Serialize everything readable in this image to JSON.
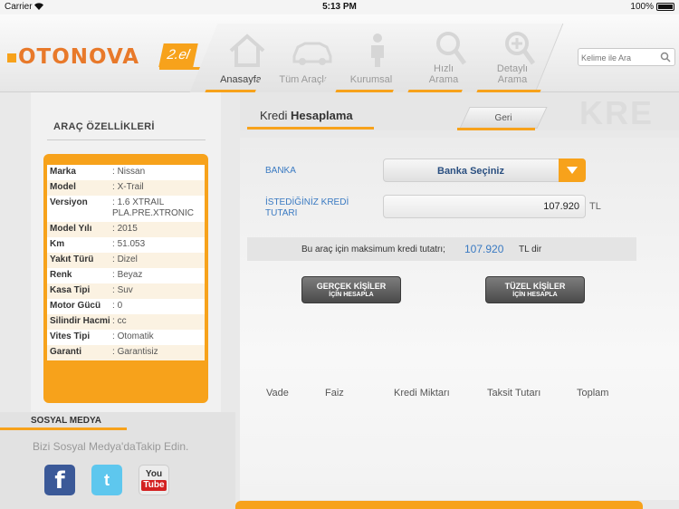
{
  "status_bar": {
    "carrier": "Carrier",
    "time": "5:13 PM",
    "battery": "100%"
  },
  "header": {
    "logo_text": "OTONOVA",
    "logo_badge": "2.el",
    "nav": [
      {
        "label": "Anasayfa",
        "icon": "home-icon"
      },
      {
        "label": "Tüm Araçlar",
        "icon": "cars-icon"
      },
      {
        "label": "Kurumsal",
        "icon": "person-icon"
      },
      {
        "label": "Hızlı\nArama",
        "icon": "magnifier-icon"
      },
      {
        "label": "Detaylı\nArama",
        "icon": "magnifier-plus-icon"
      }
    ],
    "search_placeholder": "Kelime ile Ara"
  },
  "sidebar": {
    "title": "ARAÇ ÖZELLİKLERİ",
    "specs": [
      {
        "key": "Marka",
        "value": "Nissan"
      },
      {
        "key": "Model",
        "value": "X-Trail"
      },
      {
        "key": "Versiyon",
        "value": "1.6 XTRAIL PLA.PRE.XTRONIC"
      },
      {
        "key": "Model Yılı",
        "value": "2015"
      },
      {
        "key": "Km",
        "value": "51.053"
      },
      {
        "key": "Yakıt Türü",
        "value": "Dizel"
      },
      {
        "key": "Renk",
        "value": "Beyaz"
      },
      {
        "key": "Kasa Tipi",
        "value": "Suv"
      },
      {
        "key": "Motor Gücü",
        "value": "0"
      },
      {
        "key": "Silindir Hacmi",
        "value": "cc"
      },
      {
        "key": "Vites Tipi",
        "value": "Otomatik"
      },
      {
        "key": "Garanti",
        "value": "Garantisiz"
      }
    ],
    "social": {
      "title": "SOSYAL MEDYA",
      "subtitle": "Bizi Sosyal Medya'daTakip Edin.",
      "facebook": "f",
      "twitter": "t",
      "youtube_you": "You",
      "youtube_tube": "Tube"
    }
  },
  "main": {
    "title_light": "Kredi",
    "title_bold": "Hesaplama",
    "back_label": "Geri",
    "watermark": "KRE",
    "banka_label": "BANKA",
    "banka_selected": "Banka Seçiniz",
    "kredi_label": "İSTEDİĞİNİZ KREDİ TUTARI",
    "kredi_value": "107.920",
    "currency": "TL",
    "max_text": "Bu araç için maksimum kredi tutatrı;",
    "max_amount": "107.920",
    "max_suffix": "TL dir",
    "btn_gercek_1": "GERÇEK KİŞİLER",
    "btn_gercek_2": "İÇİN HESAPLA",
    "btn_tuzel_1": "TÜZEL KİŞİLER",
    "btn_tuzel_2": "İÇİN HESAPLA",
    "table_headers": [
      "Vade",
      "Faiz",
      "Kredi Miktarı",
      "Taksit Tutarı",
      "Toplam"
    ]
  },
  "colors": {
    "accent": "#f7a21b",
    "link_blue": "#3a7ac2",
    "logo_orange": "#e8792a"
  }
}
